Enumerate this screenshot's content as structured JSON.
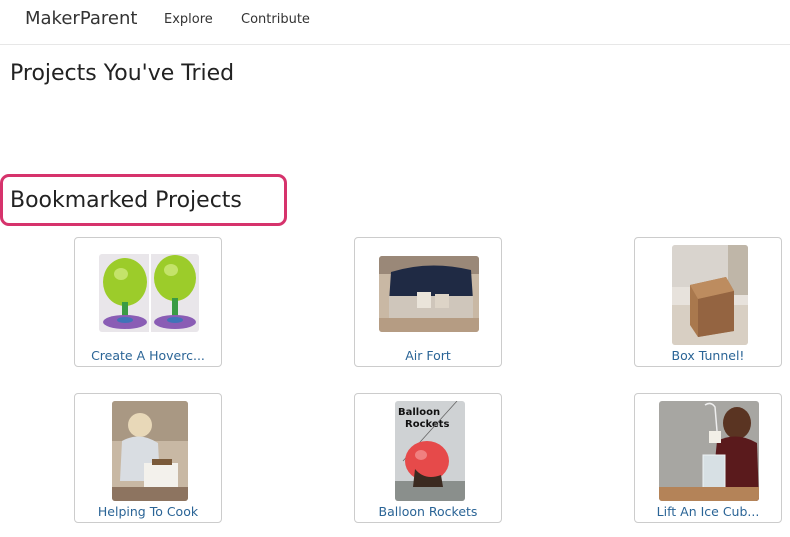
{
  "nav": {
    "brand": "MakerParent",
    "links": [
      "Explore",
      "Contribute"
    ]
  },
  "sections": {
    "tried_title": "Projects You've Tried",
    "bookmarked_title": "Bookmarked Projects"
  },
  "projects": [
    {
      "title": "Create A Hoverc..."
    },
    {
      "title": "Air Fort"
    },
    {
      "title": "Box Tunnel!"
    },
    {
      "title": "Helping To Cook"
    },
    {
      "title": "Balloon Rockets",
      "image_caption": "Balloon Rockets"
    },
    {
      "title": "Lift An Ice Cub..."
    }
  ],
  "colors": {
    "link": "#2a6496",
    "highlight": "#d6336c",
    "card_border": "#cccccc"
  }
}
